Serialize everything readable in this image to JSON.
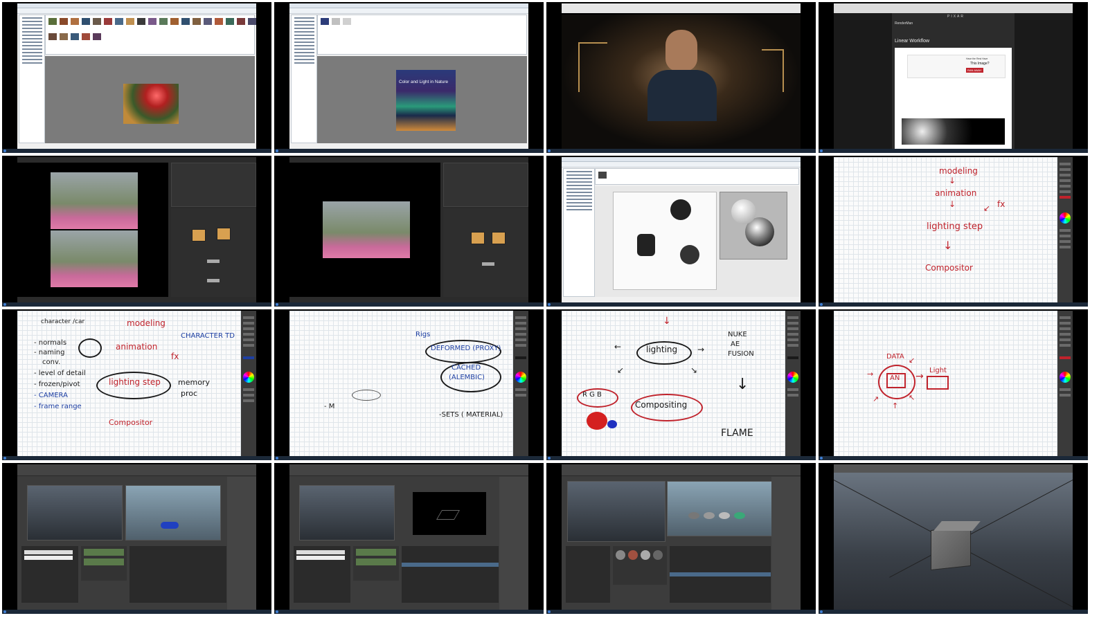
{
  "tiles": {
    "t3": {
      "webpage": {
        "brand": "PIXAR",
        "site_name": "RenderMan",
        "heading": "Linear Workflow",
        "placeholder_line1": "Have the Rest Have",
        "placeholder_line2": "This Image?",
        "placeholder_badge": "RAN AWAY"
      }
    },
    "t2": {
      "book_title": "Color and Light in Nature"
    },
    "t8": {
      "words": [
        "modeling",
        "animation",
        "fx",
        "lighting step",
        "Compositor"
      ]
    },
    "t9": {
      "words": [
        "character /car",
        "modeling",
        "animation",
        "CHARACTER TD",
        "fx",
        "- normals",
        "- naming",
        "conv.",
        "- level of detail",
        "- frozen/pivot",
        "- CAMERA",
        "- frame range",
        "lighting step",
        "memory",
        "proc",
        "Compositor"
      ]
    },
    "t10": {
      "words": [
        "Rigs",
        "DEFORMED (PROXY)",
        "CACHED",
        "(ALEMBIC)",
        "-SETS ( MATERIAL)",
        "- M"
      ]
    },
    "t11": {
      "words": [
        "lighting",
        "NUKE",
        "AE",
        "FUSION",
        "R G B",
        "Compositing",
        "FLAME"
      ]
    },
    "t12": {
      "words": [
        "DATA",
        "AN",
        "Light"
      ]
    },
    "colors": {
      "pen_red": "#c0232c",
      "pen_black": "#1a1a1a",
      "pen_blue": "#1d3fa3",
      "taskbar": "#1b2838"
    }
  }
}
